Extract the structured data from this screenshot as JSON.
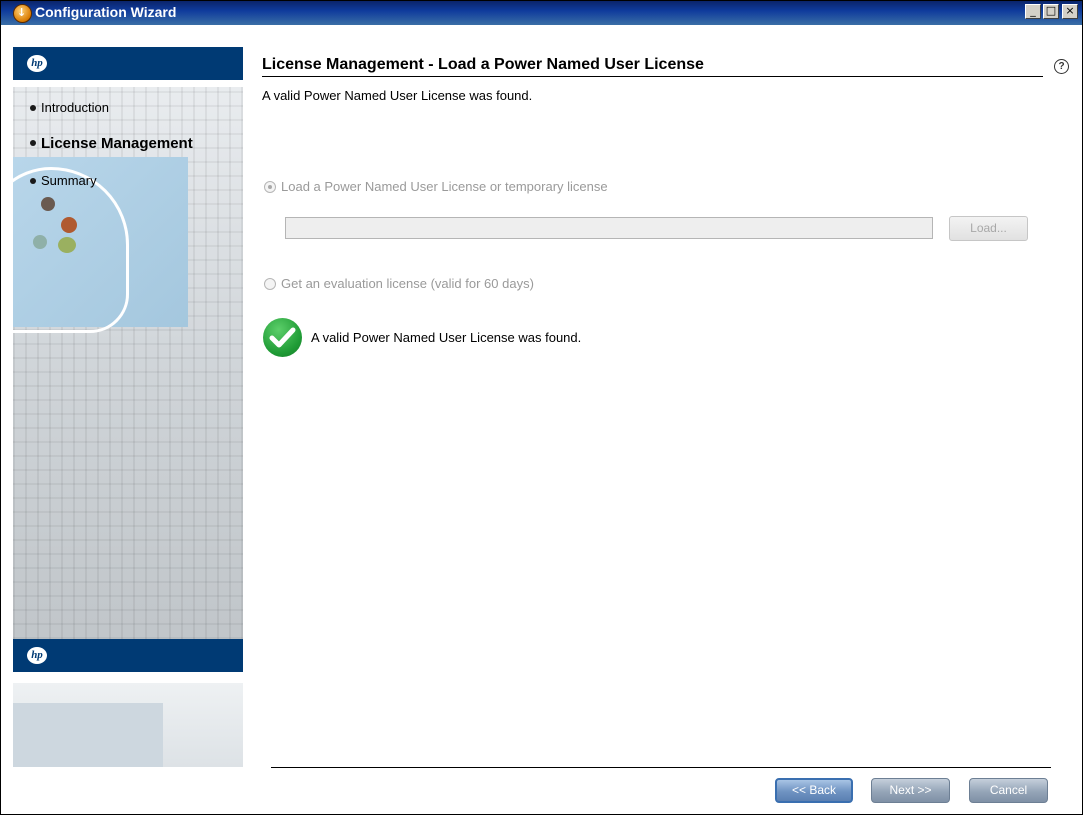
{
  "window": {
    "title": "Configuration Wizard",
    "controls": {
      "minimize": "_",
      "maximize": "□",
      "close": "×"
    }
  },
  "sidebar": {
    "logo_icon": "hp-logo",
    "items": [
      {
        "label": "Introduction",
        "active": false
      },
      {
        "label": "License Management",
        "active": true
      },
      {
        "label": "Summary",
        "active": false
      }
    ]
  },
  "main": {
    "title": "License Management - Load a Power Named User License",
    "subtitle": "A valid Power Named User License was found.",
    "options": {
      "load_label": "Load a Power Named User License or temporary license",
      "load_selected": true,
      "path_value": "",
      "load_button": "Load...",
      "eval_label": "Get an evaluation license (valid for 60 days)",
      "eval_selected": false
    },
    "status": {
      "icon": "check-circle-icon",
      "message": "A valid Power Named User License was found."
    }
  },
  "footer": {
    "back_label": "<< Back",
    "next_label": "Next >>",
    "cancel_label": "Cancel"
  },
  "colors": {
    "titlebar": "#0a246a",
    "hp_blue": "#003a74",
    "success": "#1f9b35"
  }
}
